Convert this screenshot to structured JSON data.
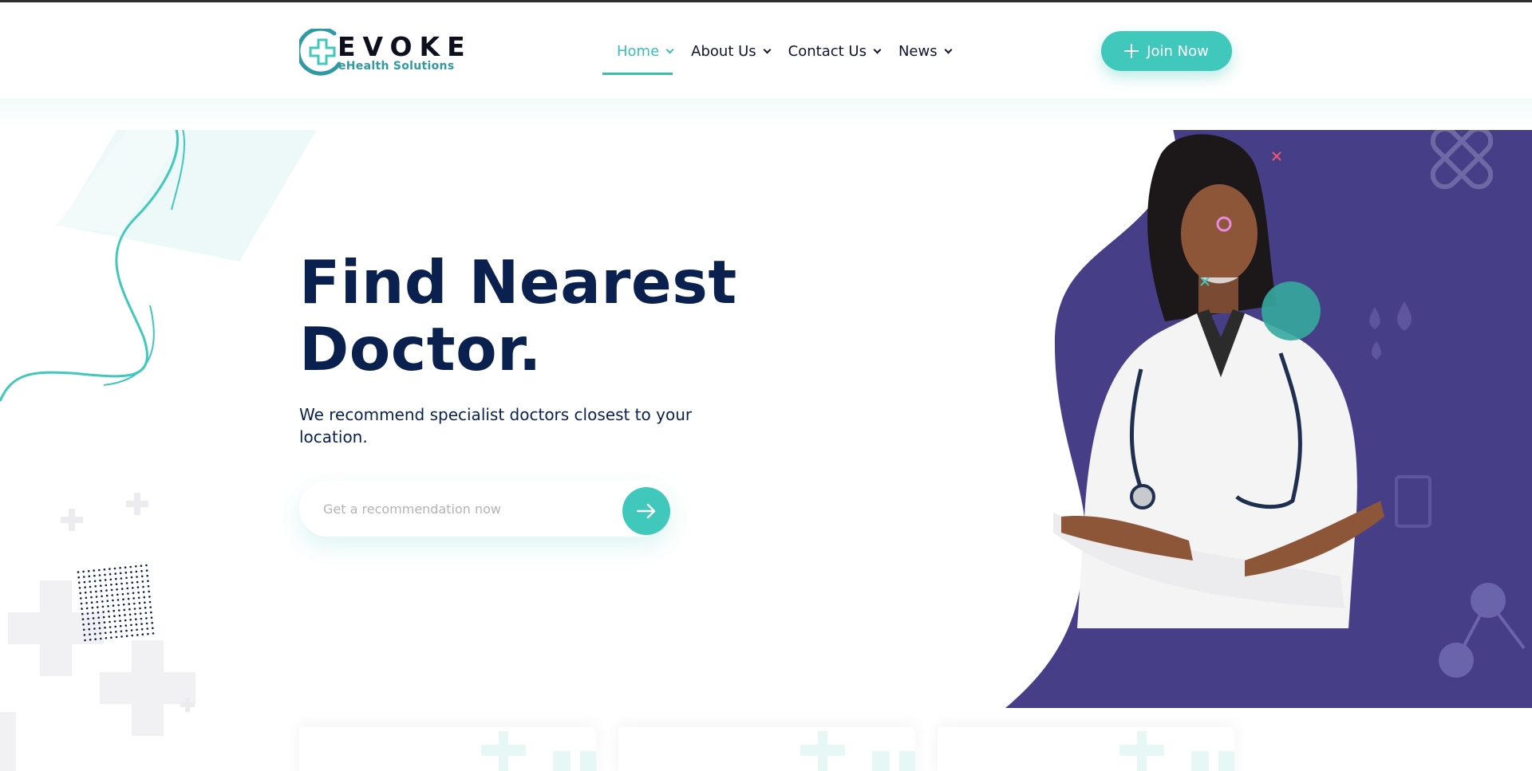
{
  "header": {
    "logo": {
      "name": "EVOKE",
      "tagline": "eHealth Solutions"
    },
    "nav": [
      {
        "label": "Home",
        "active": true
      },
      {
        "label": "About Us",
        "active": false
      },
      {
        "label": "Contact Us",
        "active": false
      },
      {
        "label": "News",
        "active": false
      }
    ],
    "join_button": "Join Now"
  },
  "hero": {
    "title_line1": "Find Nearest",
    "title_line2": "Doctor.",
    "subtitle": "We recommend specialist doctors closest to your location.",
    "search_placeholder": "Get a recommendation now",
    "image_description": "doctor-photo"
  },
  "icons": {
    "logo": "medical-cross-logo-icon",
    "nav_dropdown": "chevron-down-icon",
    "join": "plus-icon",
    "search_submit": "arrow-right-icon",
    "bandage": "bandage-icon",
    "molecule": "molecule-icon"
  },
  "colors": {
    "accent": "#3fc8bb",
    "heading": "#0a2150",
    "hero_panel": "#463f88",
    "nav_text": "#0e1430"
  }
}
